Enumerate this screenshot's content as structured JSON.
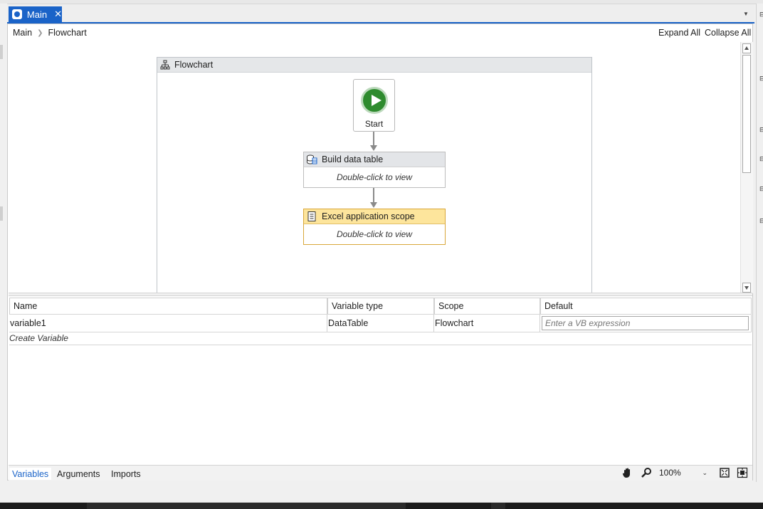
{
  "document": {
    "tab_label": "Main",
    "close_glyph": "✕"
  },
  "breadcrumb": {
    "items": [
      "Main",
      "Flowchart"
    ]
  },
  "toolbar": {
    "expand_all": "Expand All",
    "collapse_all": "Collapse All"
  },
  "flowchart": {
    "title": "Flowchart",
    "start_label": "Start",
    "activities": [
      {
        "title": "Build data table",
        "body": "Double-click to view",
        "icon": "data-table-icon"
      },
      {
        "title": "Excel application scope",
        "body": "Double-click to view",
        "icon": "excel-scope-icon"
      }
    ]
  },
  "variables": {
    "columns": [
      "Name",
      "Variable type",
      "Scope",
      "Default"
    ],
    "rows": [
      {
        "name": "variable1",
        "type": "DataTable",
        "scope": "Flowchart",
        "default_placeholder": "Enter a VB expression"
      }
    ],
    "create_label": "Create Variable"
  },
  "bottom_tabs": [
    "Variables",
    "Arguments",
    "Imports"
  ],
  "status": {
    "zoom": "100%"
  },
  "colors": {
    "accent": "#1a63c8",
    "start_green": "#2e8b2e",
    "excel_header": "#fde59c"
  }
}
